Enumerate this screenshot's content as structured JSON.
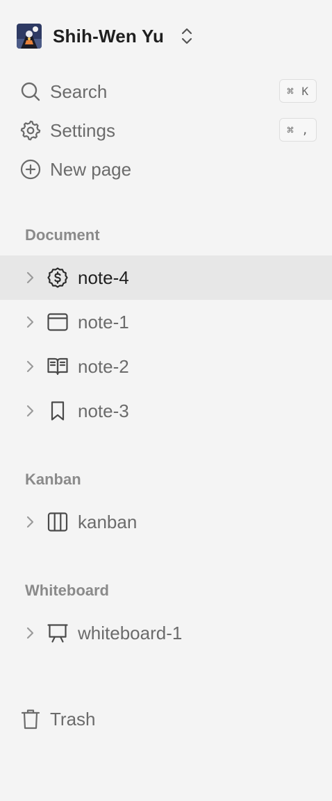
{
  "workspace": {
    "name": "Shih-Wen Yu",
    "avatar_icon": "user-avatar",
    "switcher_icon": "chevron-up-down-icon"
  },
  "actions": {
    "search": {
      "label": "Search",
      "shortcut": "⌘ K",
      "icon": "search-icon"
    },
    "settings": {
      "label": "Settings",
      "shortcut": "⌘ ,",
      "icon": "gear-icon"
    },
    "new_page": {
      "label": "New page",
      "icon": "plus-circle-icon"
    }
  },
  "sections": {
    "document": {
      "title": "Document",
      "items": [
        {
          "label": "note-4",
          "icon": "dollar-circle-icon",
          "selected": true
        },
        {
          "label": "note-1",
          "icon": "browser-window-icon"
        },
        {
          "label": "note-2",
          "icon": "open-book-icon"
        },
        {
          "label": "note-3",
          "icon": "bookmark-icon"
        }
      ]
    },
    "kanban": {
      "title": "Kanban",
      "items": [
        {
          "label": "kanban",
          "icon": "columns-icon"
        }
      ]
    },
    "whiteboard": {
      "title": "Whiteboard",
      "items": [
        {
          "label": "whiteboard-1",
          "icon": "presentation-board-icon"
        }
      ]
    }
  },
  "trash": {
    "label": "Trash",
    "icon": "trash-icon"
  },
  "colors": {
    "background": "#f4f4f4",
    "selected_row": "#e7e7e7",
    "text_primary": "#1f1f1f",
    "text_secondary": "#6b6b6b",
    "section_title": "#8a8a8a"
  }
}
